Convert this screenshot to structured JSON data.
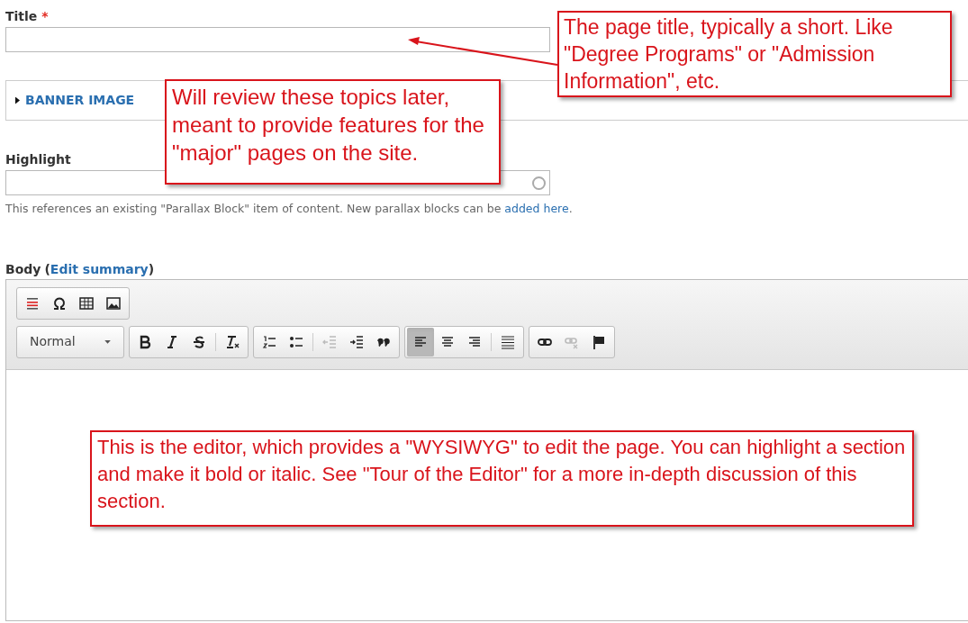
{
  "title_field": {
    "label": "Title",
    "required_mark": "*"
  },
  "banner": {
    "label": "BANNER IMAGE",
    "expanded": false
  },
  "highlight_field": {
    "label": "Highlight",
    "help": "This references an existing \"Parallax Block\" item of content. New parallax blocks can be ",
    "help_link": "added here",
    "help_end": "."
  },
  "body_field": {
    "label": "Body",
    "summary_open": "(",
    "summary_link": "Edit summary",
    "summary_close": ")"
  },
  "toolbar_rows": [
    {
      "groups": [
        [
          {
            "kind": "template",
            "disabled": false,
            "selected": false
          },
          {
            "kind": "omega",
            "disabled": false,
            "selected": false
          },
          {
            "kind": "table",
            "disabled": false,
            "selected": false
          },
          {
            "kind": "image",
            "disabled": false,
            "selected": false
          }
        ]
      ]
    },
    {
      "format": "Normal",
      "groups": [
        [
          {
            "kind": "bold",
            "disabled": false,
            "selected": false
          },
          {
            "kind": "italic",
            "disabled": false,
            "selected": false
          },
          {
            "kind": "strike",
            "disabled": false,
            "selected": false
          },
          {
            "kind": "sep"
          },
          {
            "kind": "clear",
            "disabled": false,
            "selected": false
          }
        ],
        [
          {
            "kind": "ol",
            "disabled": false,
            "selected": false
          },
          {
            "kind": "ul",
            "disabled": false,
            "selected": false
          },
          {
            "kind": "sep"
          },
          {
            "kind": "outdent",
            "disabled": true,
            "selected": false
          },
          {
            "kind": "indent",
            "disabled": false,
            "selected": false
          },
          {
            "kind": "quote",
            "disabled": false,
            "selected": false
          }
        ],
        [
          {
            "kind": "alignleft",
            "disabled": false,
            "selected": true
          },
          {
            "kind": "aligncenter",
            "disabled": false,
            "selected": false
          },
          {
            "kind": "alignright",
            "disabled": false,
            "selected": false
          },
          {
            "kind": "sep"
          },
          {
            "kind": "hr",
            "disabled": false,
            "selected": false
          }
        ],
        [
          {
            "kind": "link",
            "disabled": false,
            "selected": false
          },
          {
            "kind": "unlink",
            "disabled": true,
            "selected": false
          },
          {
            "kind": "flag",
            "disabled": false,
            "selected": false
          }
        ]
      ]
    }
  ],
  "callouts": [
    {
      "kind": "title",
      "text": "The page title, typically a short. Like \"Degree Programs\" or \"Admission Information\", etc."
    },
    {
      "kind": "banner",
      "text": "Will review these topics later, meant to provide features for the \"major\" pages on the site."
    },
    {
      "kind": "editor",
      "text": "This is the editor, which provides a \"WYSIWYG\" to edit the page. You can highlight a section and make it bold or italic. See \"Tour of the Editor\" for a more in-depth discussion of this section."
    }
  ]
}
